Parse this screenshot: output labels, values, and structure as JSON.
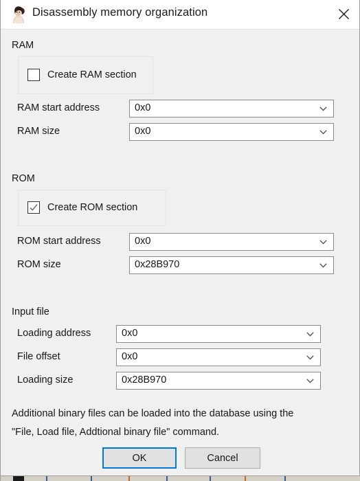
{
  "window": {
    "title": "Disassembly memory organization",
    "icon": "ida-logo-icon",
    "close_icon": "close-icon"
  },
  "sections": {
    "ram": {
      "header": "RAM",
      "checkbox": {
        "label": "Create RAM section",
        "checked": false
      },
      "fields": [
        {
          "label": "RAM start address",
          "value": "0x0"
        },
        {
          "label": "RAM size",
          "value": "0x0"
        }
      ]
    },
    "rom": {
      "header": "ROM",
      "checkbox": {
        "label": "Create ROM section",
        "checked": true
      },
      "fields": [
        {
          "label": "ROM start address",
          "value": "0x0"
        },
        {
          "label": "ROM size",
          "value": "0x28B970"
        }
      ]
    },
    "input_file": {
      "header": "Input file",
      "fields": [
        {
          "label": "Loading address",
          "value": "0x0"
        },
        {
          "label": "File offset",
          "value": "0x0"
        },
        {
          "label": "Loading size",
          "value": "0x28B970"
        }
      ]
    }
  },
  "hint": {
    "line1": "Additional binary files can be loaded into the database using the",
    "line2": "\"File, Load file, Addtional binary file\" command."
  },
  "buttons": {
    "ok": "OK",
    "cancel": "Cancel"
  },
  "colors": {
    "dialog_background": "#F0F0F0",
    "titlebar_background": "#FFFFFF",
    "focus_accent": "#0078D7",
    "text": "#171717",
    "field_border": "#8B8B8B",
    "button_face": "#E1E1E1"
  }
}
